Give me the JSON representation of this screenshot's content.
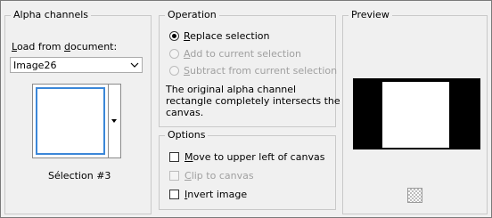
{
  "alpha_channels": {
    "title": "Alpha channels",
    "load_from": {
      "pre": "",
      "ul": "L",
      "post": "oad from ",
      "ul2": "d",
      "post2": "ocument:"
    },
    "document_value": "Image26",
    "selection_name": "Sélection #3"
  },
  "operation": {
    "title": "Operation",
    "options": [
      {
        "pre": "",
        "ul": "R",
        "post": "eplace selection",
        "selected": true,
        "enabled": true
      },
      {
        "pre": "",
        "ul": "A",
        "post": "dd to current selection",
        "selected": false,
        "enabled": false
      },
      {
        "pre": "",
        "ul": "S",
        "post": "ubtract from current selection",
        "selected": false,
        "enabled": false
      }
    ],
    "description_lines": [
      "The original alpha channel",
      "rectangle completely intersects the",
      "canvas."
    ]
  },
  "options_group": {
    "title": "Options",
    "items": [
      {
        "pre": "",
        "ul": "M",
        "post": "ove to upper left of canvas",
        "checked": false,
        "enabled": true
      },
      {
        "pre": "",
        "ul": "C",
        "post": "lip to canvas",
        "checked": false,
        "enabled": false
      },
      {
        "pre": "",
        "ul": "I",
        "post": "nvert image",
        "checked": false,
        "enabled": true
      }
    ]
  },
  "preview": {
    "title": "Preview",
    "icon": "checkerboard-icon"
  },
  "colors": {
    "selection_border": "#3b87d8",
    "preview_background": "#000000",
    "preview_canvas": "#ffffff"
  }
}
